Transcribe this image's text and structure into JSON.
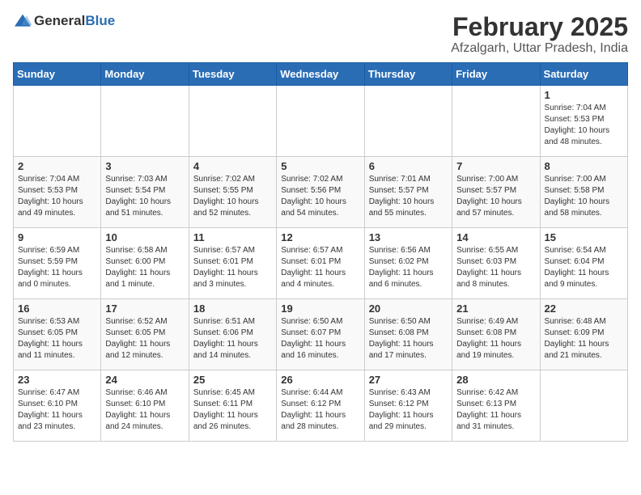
{
  "header": {
    "logo_general": "General",
    "logo_blue": "Blue",
    "month": "February 2025",
    "location": "Afzalgarh, Uttar Pradesh, India"
  },
  "days_of_week": [
    "Sunday",
    "Monday",
    "Tuesday",
    "Wednesday",
    "Thursday",
    "Friday",
    "Saturday"
  ],
  "weeks": [
    [
      {
        "day": "",
        "info": ""
      },
      {
        "day": "",
        "info": ""
      },
      {
        "day": "",
        "info": ""
      },
      {
        "day": "",
        "info": ""
      },
      {
        "day": "",
        "info": ""
      },
      {
        "day": "",
        "info": ""
      },
      {
        "day": "1",
        "info": "Sunrise: 7:04 AM\nSunset: 5:53 PM\nDaylight: 10 hours\nand 48 minutes."
      }
    ],
    [
      {
        "day": "2",
        "info": "Sunrise: 7:04 AM\nSunset: 5:53 PM\nDaylight: 10 hours\nand 49 minutes."
      },
      {
        "day": "3",
        "info": "Sunrise: 7:03 AM\nSunset: 5:54 PM\nDaylight: 10 hours\nand 51 minutes."
      },
      {
        "day": "4",
        "info": "Sunrise: 7:02 AM\nSunset: 5:55 PM\nDaylight: 10 hours\nand 52 minutes."
      },
      {
        "day": "5",
        "info": "Sunrise: 7:02 AM\nSunset: 5:56 PM\nDaylight: 10 hours\nand 54 minutes."
      },
      {
        "day": "6",
        "info": "Sunrise: 7:01 AM\nSunset: 5:57 PM\nDaylight: 10 hours\nand 55 minutes."
      },
      {
        "day": "7",
        "info": "Sunrise: 7:00 AM\nSunset: 5:57 PM\nDaylight: 10 hours\nand 57 minutes."
      },
      {
        "day": "8",
        "info": "Sunrise: 7:00 AM\nSunset: 5:58 PM\nDaylight: 10 hours\nand 58 minutes."
      }
    ],
    [
      {
        "day": "9",
        "info": "Sunrise: 6:59 AM\nSunset: 5:59 PM\nDaylight: 11 hours\nand 0 minutes."
      },
      {
        "day": "10",
        "info": "Sunrise: 6:58 AM\nSunset: 6:00 PM\nDaylight: 11 hours\nand 1 minute."
      },
      {
        "day": "11",
        "info": "Sunrise: 6:57 AM\nSunset: 6:01 PM\nDaylight: 11 hours\nand 3 minutes."
      },
      {
        "day": "12",
        "info": "Sunrise: 6:57 AM\nSunset: 6:01 PM\nDaylight: 11 hours\nand 4 minutes."
      },
      {
        "day": "13",
        "info": "Sunrise: 6:56 AM\nSunset: 6:02 PM\nDaylight: 11 hours\nand 6 minutes."
      },
      {
        "day": "14",
        "info": "Sunrise: 6:55 AM\nSunset: 6:03 PM\nDaylight: 11 hours\nand 8 minutes."
      },
      {
        "day": "15",
        "info": "Sunrise: 6:54 AM\nSunset: 6:04 PM\nDaylight: 11 hours\nand 9 minutes."
      }
    ],
    [
      {
        "day": "16",
        "info": "Sunrise: 6:53 AM\nSunset: 6:05 PM\nDaylight: 11 hours\nand 11 minutes."
      },
      {
        "day": "17",
        "info": "Sunrise: 6:52 AM\nSunset: 6:05 PM\nDaylight: 11 hours\nand 12 minutes."
      },
      {
        "day": "18",
        "info": "Sunrise: 6:51 AM\nSunset: 6:06 PM\nDaylight: 11 hours\nand 14 minutes."
      },
      {
        "day": "19",
        "info": "Sunrise: 6:50 AM\nSunset: 6:07 PM\nDaylight: 11 hours\nand 16 minutes."
      },
      {
        "day": "20",
        "info": "Sunrise: 6:50 AM\nSunset: 6:08 PM\nDaylight: 11 hours\nand 17 minutes."
      },
      {
        "day": "21",
        "info": "Sunrise: 6:49 AM\nSunset: 6:08 PM\nDaylight: 11 hours\nand 19 minutes."
      },
      {
        "day": "22",
        "info": "Sunrise: 6:48 AM\nSunset: 6:09 PM\nDaylight: 11 hours\nand 21 minutes."
      }
    ],
    [
      {
        "day": "23",
        "info": "Sunrise: 6:47 AM\nSunset: 6:10 PM\nDaylight: 11 hours\nand 23 minutes."
      },
      {
        "day": "24",
        "info": "Sunrise: 6:46 AM\nSunset: 6:10 PM\nDaylight: 11 hours\nand 24 minutes."
      },
      {
        "day": "25",
        "info": "Sunrise: 6:45 AM\nSunset: 6:11 PM\nDaylight: 11 hours\nand 26 minutes."
      },
      {
        "day": "26",
        "info": "Sunrise: 6:44 AM\nSunset: 6:12 PM\nDaylight: 11 hours\nand 28 minutes."
      },
      {
        "day": "27",
        "info": "Sunrise: 6:43 AM\nSunset: 6:12 PM\nDaylight: 11 hours\nand 29 minutes."
      },
      {
        "day": "28",
        "info": "Sunrise: 6:42 AM\nSunset: 6:13 PM\nDaylight: 11 hours\nand 31 minutes."
      },
      {
        "day": "",
        "info": ""
      }
    ]
  ]
}
